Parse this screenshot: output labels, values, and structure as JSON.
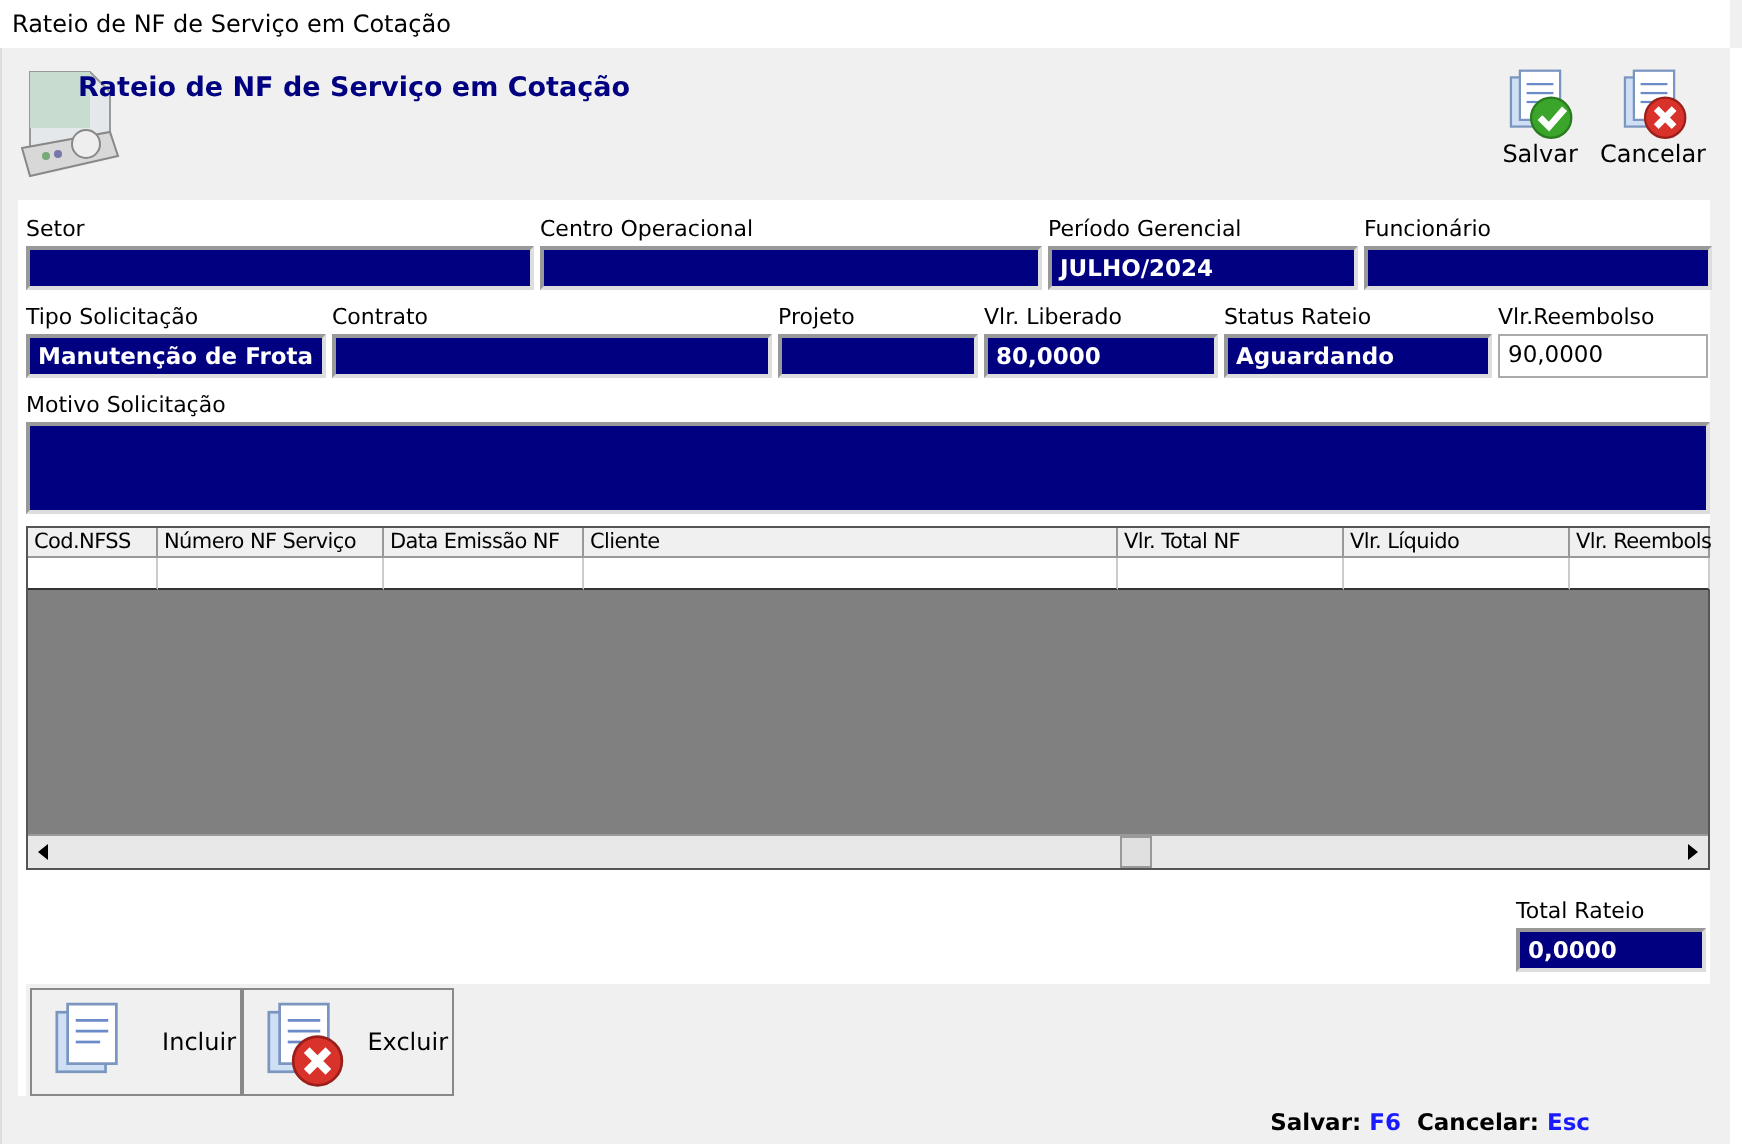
{
  "window": {
    "title": "Rateio de NF de Serviço em Cotação"
  },
  "header": {
    "title": "Rateio de NF de Serviço em Cotação"
  },
  "toolbar": [
    {
      "label": "Salvar",
      "kind": "save"
    },
    {
      "label": "Cancelar",
      "kind": "cancel"
    }
  ],
  "fields": [
    {
      "label": "Setor",
      "kind": "readonly"
    },
    {
      "label": "Centro Operacional",
      "kind": "readonly"
    },
    {
      "label": "Período Gerencial",
      "value": "JULHO/2024",
      "kind": "readonly"
    },
    {
      "label": "Funcionário",
      "kind": "readonly"
    }
  ],
  "fields2": [
    {
      "label": "Tipo Solicitação",
      "value": "Manutenção de Frota",
      "kind": "readonly"
    },
    {
      "label": "Contrato",
      "kind": "readonly"
    },
    {
      "label": "Projeto",
      "kind": "readonly"
    },
    {
      "label": "Vlr. Liberado",
      "value": "80,0000",
      "kind": "readonly"
    },
    {
      "label": "Status Rateio",
      "value": "Aguardando",
      "kind": "readonly"
    },
    {
      "label": "Vlr.Reembolso",
      "value": "90,0000",
      "kind": "editable"
    }
  ],
  "motivo": {
    "label": "Motivo Solicitação"
  },
  "table": {
    "columns": [
      "Cod.NFSS",
      "Número NF Serviço",
      "Data Emissão NF",
      "Cliente",
      "Vlr. Total NF",
      "Vlr. Líquido",
      "Vlr. Reembols"
    ]
  },
  "total": {
    "label": "Total Rateio",
    "value": "0,0000"
  },
  "actions": [
    {
      "label": "Incluir",
      "kind": "add"
    },
    {
      "label": "Excluir",
      "kind": "delete"
    }
  ],
  "status_bar": [
    {
      "label": "Salvar:",
      "key": "F6"
    },
    {
      "label": "Cancelar:",
      "key": "Esc"
    }
  ]
}
